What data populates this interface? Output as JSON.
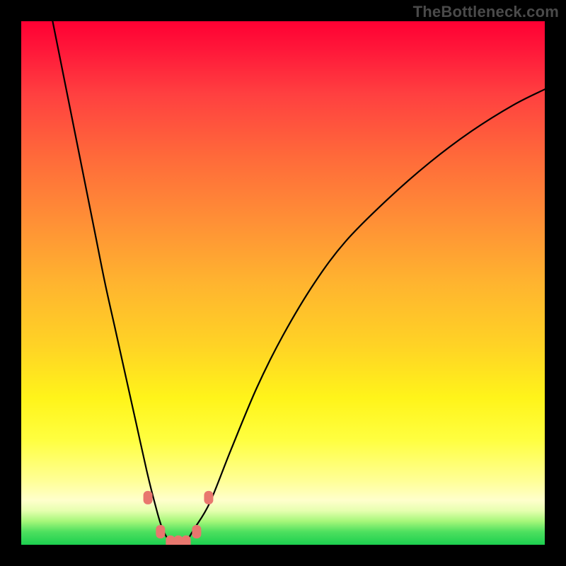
{
  "watermark": "TheBottleneck.com",
  "chart_data": {
    "type": "line",
    "title": "",
    "xlabel": "",
    "ylabel": "",
    "xlim": [
      0,
      100
    ],
    "ylim": [
      0,
      100
    ],
    "series": [
      {
        "name": "curve",
        "x": [
          6,
          8,
          10,
          12,
          14,
          16,
          18,
          20,
          22,
          24,
          25.5,
          27,
          29,
          31,
          33,
          36,
          40,
          45,
          50,
          56,
          62,
          70,
          78,
          86,
          94,
          100
        ],
        "values": [
          100,
          90,
          80,
          70,
          60,
          50,
          41,
          32,
          23,
          14,
          8,
          3,
          0,
          0,
          3,
          8,
          18,
          30,
          40,
          50,
          58,
          66,
          73,
          79,
          84,
          87
        ]
      }
    ],
    "markers": [
      {
        "x": 24.2,
        "y": 9.0
      },
      {
        "x": 26.6,
        "y": 2.5
      },
      {
        "x": 28.5,
        "y": 0.5
      },
      {
        "x": 30.0,
        "y": 0.5
      },
      {
        "x": 31.5,
        "y": 0.5
      },
      {
        "x": 33.5,
        "y": 2.5
      },
      {
        "x": 35.8,
        "y": 9.0
      }
    ],
    "gradient_note": "background color encodes y value: red=high, yellow=mid, green=low"
  }
}
